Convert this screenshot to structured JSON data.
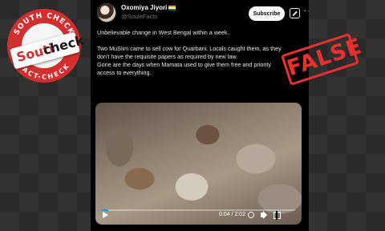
{
  "tweet": {
    "author_name": "Oxomiya Jiyori",
    "author_handle": "@SouleFacts",
    "subscribe_label": "Subscribe",
    "text_lines": [
      "Unbelievable change in West Bengal within a week.",
      "Two MuSlim came to sell cow for Quarbani. Locals caught them, as they",
      "don't have the requisite papers as required by new law.",
      "Gone are the days when Mamata used to give them free and priority",
      "access to everything."
    ]
  },
  "video": {
    "time": "0:04 / 2:02",
    "progress_fraction": 0.033
  },
  "logo": {
    "top_arc": "SOUTH CHECK",
    "bottom_arc": "FACT-CHECK",
    "wordmark_left": "Souti",
    "wordmark_right": "check"
  },
  "stamp": {
    "text": "FALSE",
    "color": "#e8312f"
  },
  "colors": {
    "accent": "#1d9bf0",
    "stamp": "#e8312f",
    "logo_red": "#d32f2f"
  }
}
